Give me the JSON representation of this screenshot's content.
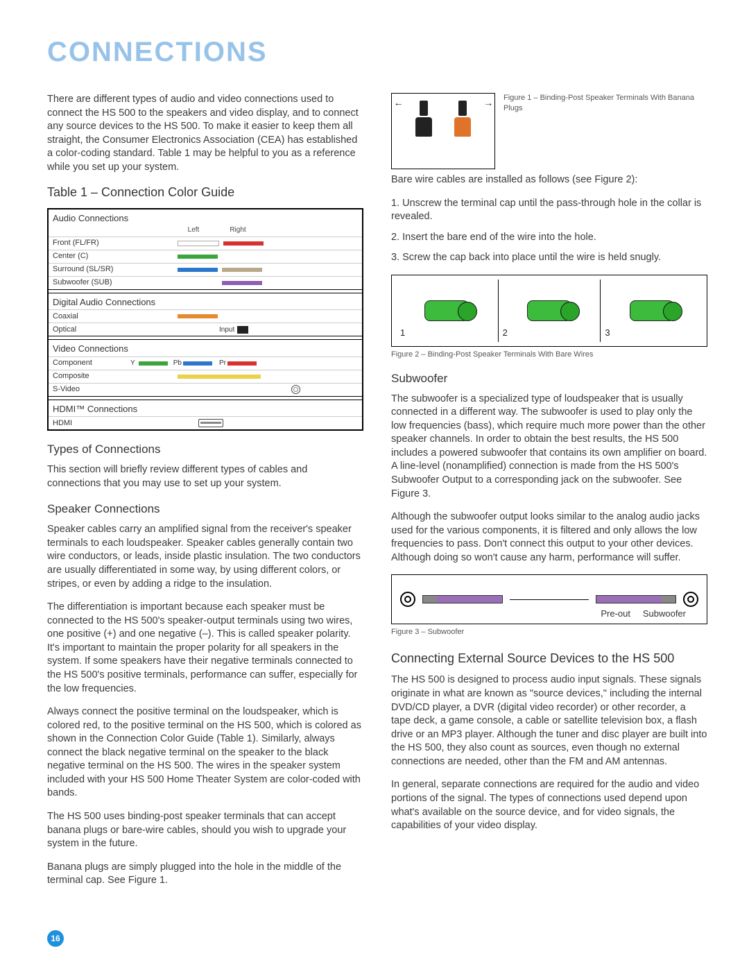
{
  "pageTitle": "CONNECTIONS",
  "pageNumber": "16",
  "intro": "There are different types of audio and video connections used to connect the HS 500 to the speakers and video display, and to connect any source devices to the HS 500. To make it easier to keep them all straight, the Consumer Electronics Association (CEA) has established a color-coding standard. Table 1 may be helpful to you as a reference while you set up your system.",
  "table1": {
    "title": "Table 1 – Connection Color Guide",
    "leftLabel": "Left",
    "rightLabel": "Right",
    "sections": [
      {
        "name": "Audio Connections",
        "rows": [
          {
            "label": "Front (FL/FR)",
            "left": "#ffffff",
            "leftBorder": "#888",
            "right": "#d93030"
          },
          {
            "label": "Center (C)",
            "left": "#3aa53a"
          },
          {
            "label": "Surround (SL/SR)",
            "left": "#2a77cc",
            "right": "#b8a98a"
          },
          {
            "label": "Subwoofer (SUB)",
            "left": "#8e5fb5"
          }
        ]
      },
      {
        "name": "Digital Audio Connections",
        "rows": [
          {
            "label": "Coaxial",
            "left": "#e58a2e"
          },
          {
            "label": "Optical",
            "left": null,
            "extra": "Input"
          }
        ]
      },
      {
        "name": "Video Connections",
        "rows": [
          {
            "label": "Component",
            "trip": [
              "Y",
              "#3aa53a",
              "Pb",
              "#2a77cc",
              "Pr",
              "#d93030"
            ]
          },
          {
            "label": "Composite",
            "left": "#e9d24a"
          },
          {
            "label": "S-Video",
            "svideo": true
          }
        ]
      },
      {
        "name": "HDMI™ Connections",
        "rows": [
          {
            "label": "HDMI",
            "hdmi": true
          }
        ]
      }
    ]
  },
  "h_types": "Types of Connections",
  "p_types": "This section will briefly review different types of cables and connections that you may use to set up your system.",
  "h_speaker": "Speaker Connections",
  "p_sp1": "Speaker cables carry an amplified signal from the receiver's speaker terminals to each loudspeaker. Speaker cables generally contain two wire conductors, or leads, inside plastic insulation. The two conductors are usually differentiated in some way, by using different colors, or stripes, or even by adding a ridge to the insulation.",
  "p_sp2": "The differentiation is important because each speaker must be connected to the HS 500's speaker-output terminals using two wires, one positive (+) and one negative (–). This is called speaker polarity. It's important to maintain the proper polarity for all speakers in the system. If some speakers have their negative terminals connected to the HS 500's positive terminals, performance can suffer, especially for the low frequencies.",
  "p_sp3": "Always connect the positive terminal on the loudspeaker, which is colored red, to the positive terminal on the HS 500, which is colored as shown in the Connection Color Guide (Table 1). Similarly, always connect the black negative terminal on the speaker to the black negative terminal on the HS 500. The wires in the speaker system included with your HS 500 Home Theater System are color-coded with bands.",
  "p_sp4": "The HS 500 uses binding-post speaker terminals that can accept banana plugs or bare-wire cables, should you wish to upgrade your system in the future.",
  "p_sp5": "Banana plugs are simply plugged into the hole in the middle of the terminal cap. See Figure 1.",
  "fig1cap": "Figure 1 – Binding-Post Speaker Terminals With Banana Plugs",
  "p_bare": "Bare wire cables are installed as follows (see Figure 2):",
  "bare": [
    "1. Unscrew the terminal cap until the pass-through hole in the collar is revealed.",
    "2. Insert the bare end of the wire into the hole.",
    "3. Screw the cap back into place until the wire is held snugly."
  ],
  "fig2cap": "Figure 2 – Binding-Post Speaker Terminals With Bare Wires",
  "fig2steps": [
    "1",
    "2",
    "3"
  ],
  "h_sub": "Subwoofer",
  "p_sub1": "The subwoofer is a specialized type of loudspeaker that is usually connected in a different way. The subwoofer is used to play only the low frequencies (bass), which require much more power than the other speaker channels. In order to obtain the best results, the HS 500 includes a powered subwoofer that contains its own amplifier on board. A line-level (nonamplified) connection is made from the HS 500's Subwoofer Output to a corresponding jack on the subwoofer. See Figure 3.",
  "p_sub2": "Although the subwoofer output looks similar to the analog audio jacks used for the various components, it is filtered and only allows the low frequencies to pass. Don't connect this output to your other devices. Although doing so won't cause any harm, performance will suffer.",
  "fig3": {
    "preout": "Pre-out",
    "sub": "Subwoofer"
  },
  "fig3cap": "Figure 3 – Subwoofer",
  "h_ext": "Connecting External Source Devices to the HS 500",
  "p_ext1": "The HS 500 is designed to process audio input signals. These signals originate in what are known as \"source devices,\" including the internal DVD/CD player, a DVR (digital video recorder) or other recorder, a tape deck, a game console, a cable or satellite television box, a flash drive or an MP3 player. Although the tuner and disc player are built into the HS 500, they also count as sources, even though no external connections are needed, other than the FM and AM antennas.",
  "p_ext2": "In general, separate connections are required for the audio and video portions of the signal. The types of connections used depend upon what's available on the source device, and for video signals, the capabilities of your video display."
}
